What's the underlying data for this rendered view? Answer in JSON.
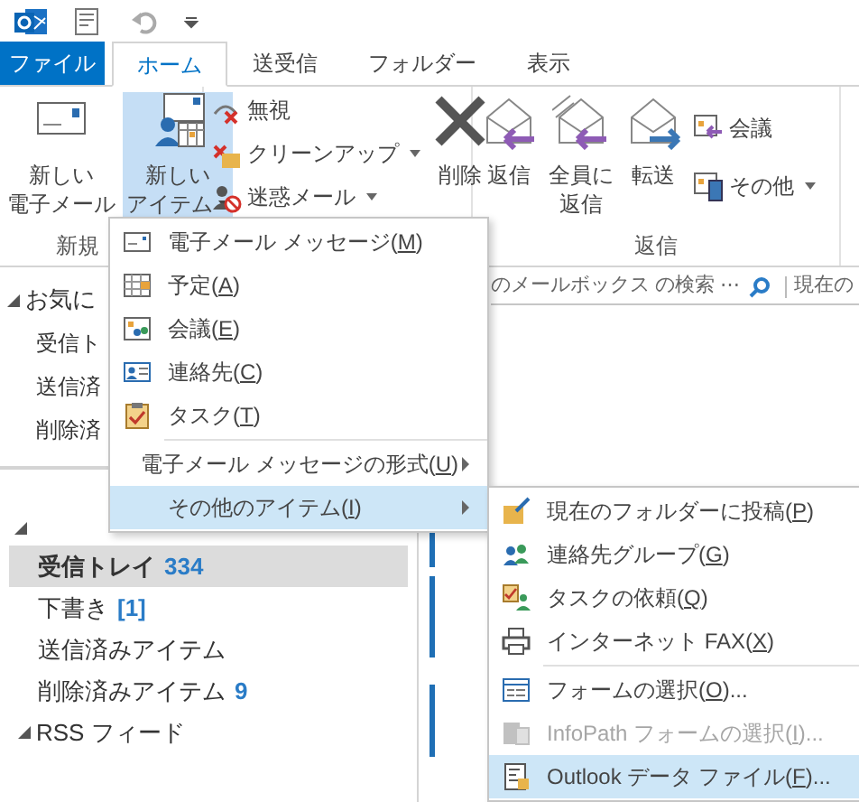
{
  "tabs": [
    {
      "label": "ファイル",
      "kind": "file",
      "selected": false
    },
    {
      "label": "ホーム",
      "kind": "tab",
      "selected": true
    },
    {
      "label": "送受信",
      "kind": "tab",
      "selected": false
    },
    {
      "label": "フォルダー",
      "kind": "tab",
      "selected": false
    },
    {
      "label": "表示",
      "kind": "tab",
      "selected": false
    }
  ],
  "ribbon": {
    "groups": [
      {
        "label": "新規",
        "buttons": [
          {
            "kind": "large",
            "lines": [
              "新しい",
              "電子メール"
            ],
            "dropdown": false,
            "pressed": false
          },
          {
            "kind": "large",
            "lines": [
              "新しい",
              "アイテム"
            ],
            "dropdown": true,
            "pressed": true
          }
        ]
      },
      {
        "buttons": [
          {
            "kind": "small",
            "lines": [
              "無視"
            ],
            "dropdown": false,
            "pressed": false
          },
          {
            "kind": "small",
            "lines": [
              "クリーンアップ"
            ],
            "dropdown": true,
            "pressed": false
          },
          {
            "kind": "small",
            "lines": [
              "迷惑メール"
            ],
            "dropdown": true,
            "pressed": false
          },
          {
            "kind": "large",
            "lines": [
              "削除"
            ],
            "dropdown": false,
            "pressed": false
          }
        ]
      },
      {
        "label": "返信",
        "buttons": [
          {
            "kind": "large",
            "lines": [
              "返信"
            ],
            "dropdown": false,
            "pressed": false
          },
          {
            "kind": "large",
            "lines": [
              "全員に",
              "返信"
            ],
            "dropdown": false,
            "pressed": false
          },
          {
            "kind": "large",
            "lines": [
              "転送"
            ],
            "dropdown": false,
            "pressed": false
          },
          {
            "kind": "small",
            "lines": [
              "会議"
            ],
            "dropdown": false,
            "pressed": false
          },
          {
            "kind": "small",
            "lines": [
              "その他"
            ],
            "dropdown": true,
            "pressed": false
          }
        ]
      }
    ]
  },
  "favorites": {
    "header": "お気に",
    "items": [
      "受信ト",
      "送信済",
      "削除済"
    ]
  },
  "mailbox": {
    "folders": [
      {
        "name": "受信トレイ",
        "count": "334",
        "selected": true
      },
      {
        "name": "下書き",
        "count": "[1]",
        "selected": false
      },
      {
        "name": "送信済みアイテム",
        "selected": false
      },
      {
        "name": "削除済みアイテム",
        "count": "9",
        "selected": false
      }
    ],
    "rss": "RSS フィード"
  },
  "search": {
    "placeholder": "のメールボックス の検索 ⋯",
    "scope": "現在の"
  },
  "new_item_menu": [
    {
      "before": "電子メール メッセージ(",
      "key": "M",
      "after": ")",
      "submenu": false,
      "selected": false
    },
    {
      "before": "予定(",
      "key": "A",
      "after": ")",
      "submenu": false,
      "selected": false
    },
    {
      "before": "会議(",
      "key": "E",
      "after": ")",
      "submenu": false,
      "selected": false
    },
    {
      "before": "連絡先(",
      "key": "C",
      "after": ")",
      "submenu": false,
      "selected": false
    },
    {
      "before": "タスク(",
      "key": "T",
      "after": ")",
      "submenu": false,
      "selected": false
    },
    {
      "before": "電子メール メッセージの形式(",
      "key": "U",
      "after": ")",
      "submenu": true,
      "selected": false
    },
    {
      "before": "その他のアイテム(",
      "key": "I",
      "after": ")",
      "submenu": true,
      "selected": true
    }
  ],
  "other_items_menu": [
    {
      "before": "現在のフォルダーに投稿(",
      "key": "P",
      "after": ")",
      "disabled": false,
      "selected": false
    },
    {
      "before": "連絡先グループ(",
      "key": "G",
      "after": ")",
      "disabled": false,
      "selected": false
    },
    {
      "before": "タスクの依頼(",
      "key": "Q",
      "after": ")",
      "disabled": false,
      "selected": false
    },
    {
      "before": "インターネット FAX(",
      "key": "X",
      "after": ")",
      "disabled": false,
      "selected": false
    },
    {
      "before": "フォームの選択(",
      "key": "O",
      "after": ")...",
      "disabled": false,
      "selected": false
    },
    {
      "before": "InfoPath フォームの選択(",
      "key": "I",
      "after": ")...",
      "disabled": true,
      "selected": false
    },
    {
      "before": "Outlook データ ファイル(",
      "key": "F",
      "after": ")...",
      "disabled": false,
      "selected": true
    }
  ]
}
